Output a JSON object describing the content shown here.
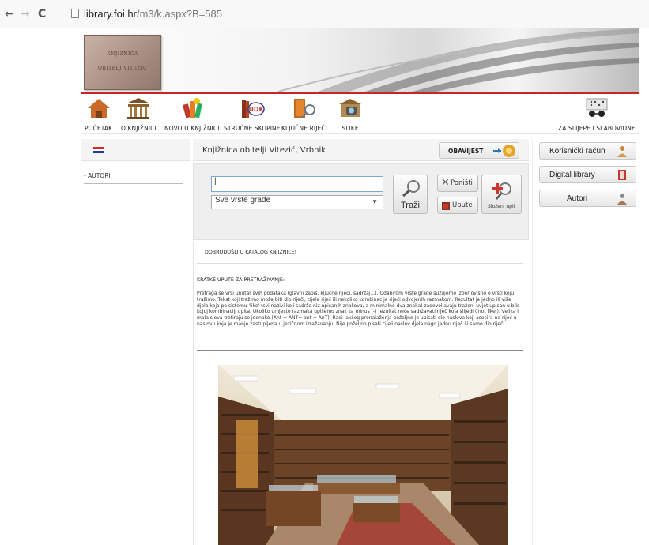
{
  "browser": {
    "url_host": "library.foi.hr",
    "url_path": "/m3/k.aspx?B=585"
  },
  "header": {
    "plaque_line1": "KNJIŽNICA",
    "plaque_line2": "OBITELJ VITEZIĆ"
  },
  "topnav": {
    "items": [
      {
        "label": "POČETAK",
        "icon": "house-icon"
      },
      {
        "label": "O KNJIŽNICI",
        "icon": "library-building-icon"
      },
      {
        "label": "NOVO U KNJIŽNICI",
        "icon": "new-books-icon"
      },
      {
        "label": "STRUČNE SKUPINE",
        "icon": "udk-books-icon"
      },
      {
        "label": "KLJUČNE RIJEČI",
        "icon": "keywords-icon"
      },
      {
        "label": "SLIKE",
        "icon": "photo-camera-icon"
      },
      {
        "label": "ZA SLIJEPE I SLABOVIDNE",
        "icon": "braille-glasses-icon"
      }
    ]
  },
  "left": {
    "link": "- AUTORI"
  },
  "main": {
    "title": "Knjižnica obitelji Vitezić, Vrbnik",
    "obavijest_label": "OBAVIJEST",
    "search": {
      "value": "|",
      "select_value": "Sve vrste građe",
      "trazi_label": "Traži",
      "ponisti_label": "Poništi",
      "upute_label": "Upute",
      "slozeni_label": "Složeni upit"
    },
    "welcome": "DOBRODOŠLI U KATALOG KNJIŽNICE!",
    "instructions_title": "KRATKE UPUTE ZA PRETRAŽIVANJE:",
    "instructions_text": "Pretraga se vrši unutar svih podataka (glavni zapis, ključne riječi, sadržaj...). Odabirom vrste građe sužujemo izbor ovisno o vrsti koju tražimo. Tekst koji tražimo može biti dio riječi, cijela riječ ili nekoliko kombinacija riječi odvojenih razmakom. Rezultat je jedno ili više djela koja po sistemu 'like' (svi nazivi koji sadrže niz upisanih znakova, a minimalno dva znaka) zadovoljavaju traženi uvjet upisan u bilo kojoj kombinaciji upita. Ukoliko umjesto razmaka upišemo znak za minus (-) rezultat neće sadržavati riječ koja slijedi ('not like'). Velika i mala slova tretiraju se jednako (Ant = ANT= ant = AnT). Radi lakšeg pronalaženja poželjno je upisati dio naslova koji asocira na riječ u naslovu koja je manje zastupljena u jezičnom izražavanju. Nije poželjno pisati cijeli naslov djela nego jednu riječ ili samo dio riječi."
  },
  "right": {
    "buttons": [
      {
        "label": "Korisnički račun",
        "icon": "user-account-icon"
      },
      {
        "label": "Digital library",
        "icon": "book-icon"
      },
      {
        "label": "Autori",
        "icon": "author-person-icon"
      }
    ]
  },
  "colors": {
    "accent_red": "#c6262a",
    "input_border": "#7aa7d8"
  }
}
